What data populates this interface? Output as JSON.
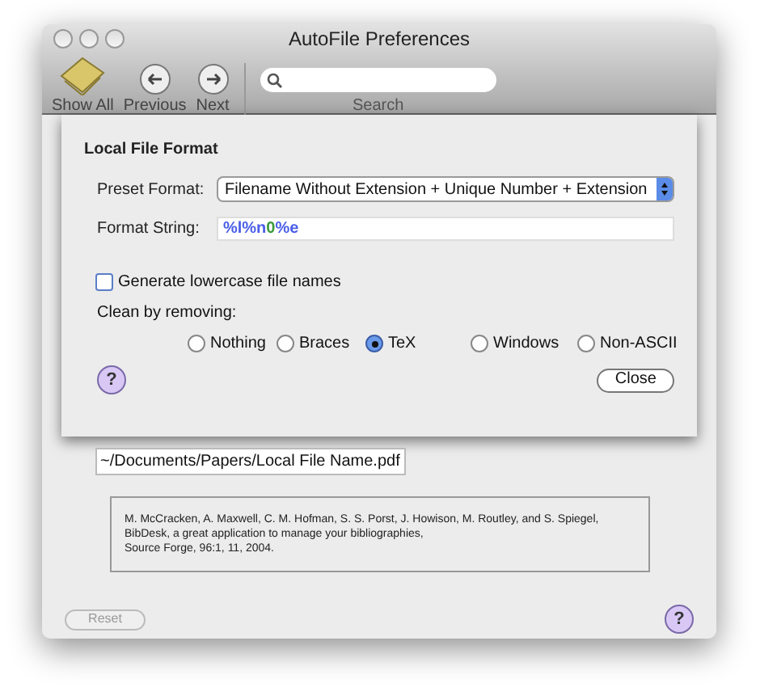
{
  "window": {
    "title": "AutoFile Preferences"
  },
  "toolbar": {
    "items": [
      {
        "label": "Show All",
        "kind": "showall"
      },
      {
        "label": "Previous",
        "kind": "prev"
      },
      {
        "label": "Next",
        "kind": "next"
      }
    ],
    "search": {
      "label": "Search"
    }
  },
  "sheet": {
    "title": "Local File Format",
    "preset_label": "Preset Format:",
    "preset_value": "Filename Without Extension + Unique Number + Extension",
    "format_label": "Format String:",
    "format_tokens": [
      {
        "text": "%l%n",
        "color": "#4a5ee8"
      },
      {
        "text": "0",
        "color": "#3a9a3a"
      },
      {
        "text": "%e",
        "color": "#4a5ee8"
      }
    ],
    "lowercase": {
      "label": "Generate lowercase file names",
      "checked": false
    },
    "clean_label": "Clean by removing:",
    "clean_options": [
      {
        "label": "Nothing",
        "selected": false
      },
      {
        "label": "Braces",
        "selected": false
      },
      {
        "label": "TeX",
        "selected": true
      },
      {
        "label": "Windows",
        "selected": false
      },
      {
        "label": "Non-ASCII",
        "selected": false
      }
    ],
    "help": "?",
    "close": "Close"
  },
  "preview_path": "~/Documents/Papers/Local File Name.pdf",
  "citation": [
    "M. McCracken, A. Maxwell, C. M. Hofman, S. S. Porst, J. Howison, M. Routley, and S. Spiegel,",
    "BibDesk, a great application to manage your bibliographies,",
    "Source Forge, 96:1, 11, 2004."
  ],
  "reset": {
    "label": "Reset",
    "disabled": true
  },
  "help": "?"
}
